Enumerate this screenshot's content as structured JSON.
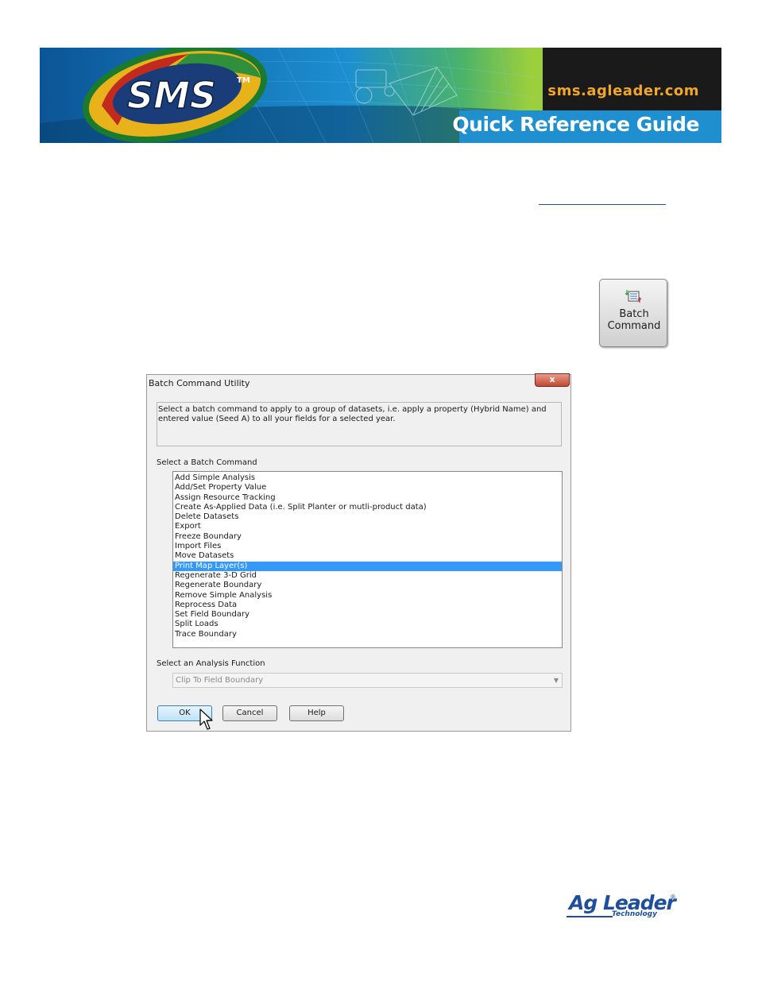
{
  "banner": {
    "logo_text": "SMS",
    "logo_tm": "TM",
    "url": "sms.agleader.com",
    "title": "Quick Reference Guide"
  },
  "batch_button": {
    "label_line1": "Batch",
    "label_line2": "Command",
    "icon": "batch-list-icon"
  },
  "dialog": {
    "title": "Batch Command Utility",
    "close_glyph": "x",
    "description": "Select a batch command to apply to a group of datasets, i.e. apply a property (Hybrid Name) and entered value (Seed A) to all your fields for a selected year.",
    "select_command_label": "Select a Batch Command",
    "commands": [
      "Add Simple Analysis",
      "Add/Set Property Value",
      "Assign Resource Tracking",
      "Create As-Applied Data (i.e. Split Planter or mutli-product data)",
      "Delete Datasets",
      "Export",
      "Freeze Boundary",
      "Import Files",
      "Move Datasets",
      "Print Map Layer(s)",
      "Regenerate 3-D Grid",
      "Regenerate Boundary",
      "Remove Simple Analysis",
      "Reprocess Data",
      "Set Field Boundary",
      "Split Loads",
      "Trace Boundary"
    ],
    "selected_command": "Print Map Layer(s)",
    "analysis_label": "Select an Analysis Function",
    "analysis_value": "Clip To Field Boundary",
    "ok_label": "OK",
    "cancel_label": "Cancel",
    "help_label": "Help"
  },
  "footer_logo": {
    "main": "Ag Leader",
    "registered": "®",
    "sub": "Technology"
  },
  "colors": {
    "selection": "#3399ff",
    "brand_blue": "#1e4f9c",
    "url_orange": "#f0a62a",
    "qrg_bar": "#1f8fd0"
  }
}
